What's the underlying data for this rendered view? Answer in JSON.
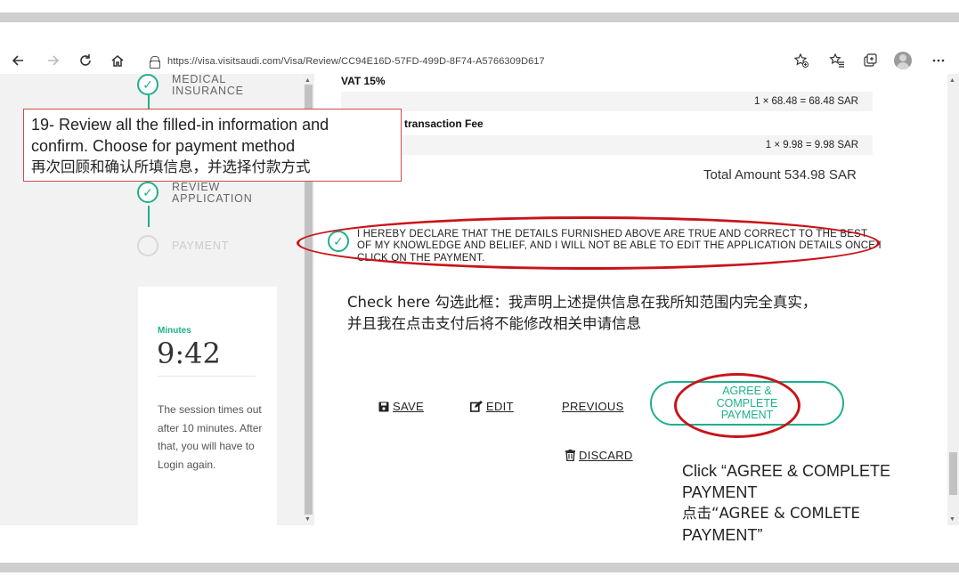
{
  "browser": {
    "url": "https://visa.visitsaudi.com/Visa/Review/CC94E16D-57FD-499D-8F74-A5766309D617",
    "icons": [
      "back-icon",
      "forward-icon",
      "refresh-icon",
      "home-icon",
      "lock-icon",
      "favorite-add-icon",
      "favorites-icon",
      "collections-icon",
      "profile-icon",
      "more-icon"
    ]
  },
  "sidebar": {
    "steps": [
      {
        "label_line1": "MEDICAL",
        "label_line2": "INSURANCE",
        "status": "done"
      },
      {
        "label_line1": "REVIEW",
        "label_line2": "APPLICATION",
        "status": "done"
      },
      {
        "label_line1": "PAYMENT",
        "label_line2": "",
        "status": "pending"
      }
    ],
    "session": {
      "minutes_label": "Minutes",
      "time": "9:42",
      "message": "The session times out after 10 minutes. After that, you will have to Login again."
    }
  },
  "review": {
    "vat_title": "VAT 15%",
    "vat_calc": "1 × 68.48 = 68.48 SAR",
    "fee_title": "transaction Fee",
    "fee_calc": "1 × 9.98 = 9.98 SAR",
    "total": "Total Amount 534.98 SAR",
    "declaration": "I HEREBY DECLARE THAT THE DETAILS FURNISHED ABOVE ARE TRUE AND CORRECT TO THE BEST OF MY KNOWLEDGE AND BELIEF, AND I WILL NOT BE ABLE TO EDIT THE APPLICATION DETAILS ONCE I CLICK ON THE PAYMENT.",
    "declaration_checked": true
  },
  "actions": {
    "save": "SAVE",
    "edit": "EDIT",
    "previous": "PREVIOUS",
    "agree": "AGREE & COMPLETE PAYMENT",
    "discard": "DISCARD"
  },
  "annotations": {
    "step_note_en1": "19- Review all the filled-in information and",
    "step_note_en2": "confirm. Choose for payment method",
    "step_note_cn": "再次回顾和确认所填信息，并选择付款方式",
    "check_note_line1": "Check here 勾选此框：我声明上述提供信息在我所知范围内完全真实，",
    "check_note_line2": "并且我在点击支付后将不能修改相关申请信息",
    "click_note_line1": "Click “AGREE & COMPLETE",
    "click_note_line2": "PAYMENT",
    "click_note_line3": "点击“AGREE & COMLETE",
    "click_note_line4": "PAYMENT”",
    "highlight_color": "#c8141a"
  },
  "colors": {
    "accent": "#1fb08c",
    "sidebar_bg": "#f2f2f2"
  }
}
